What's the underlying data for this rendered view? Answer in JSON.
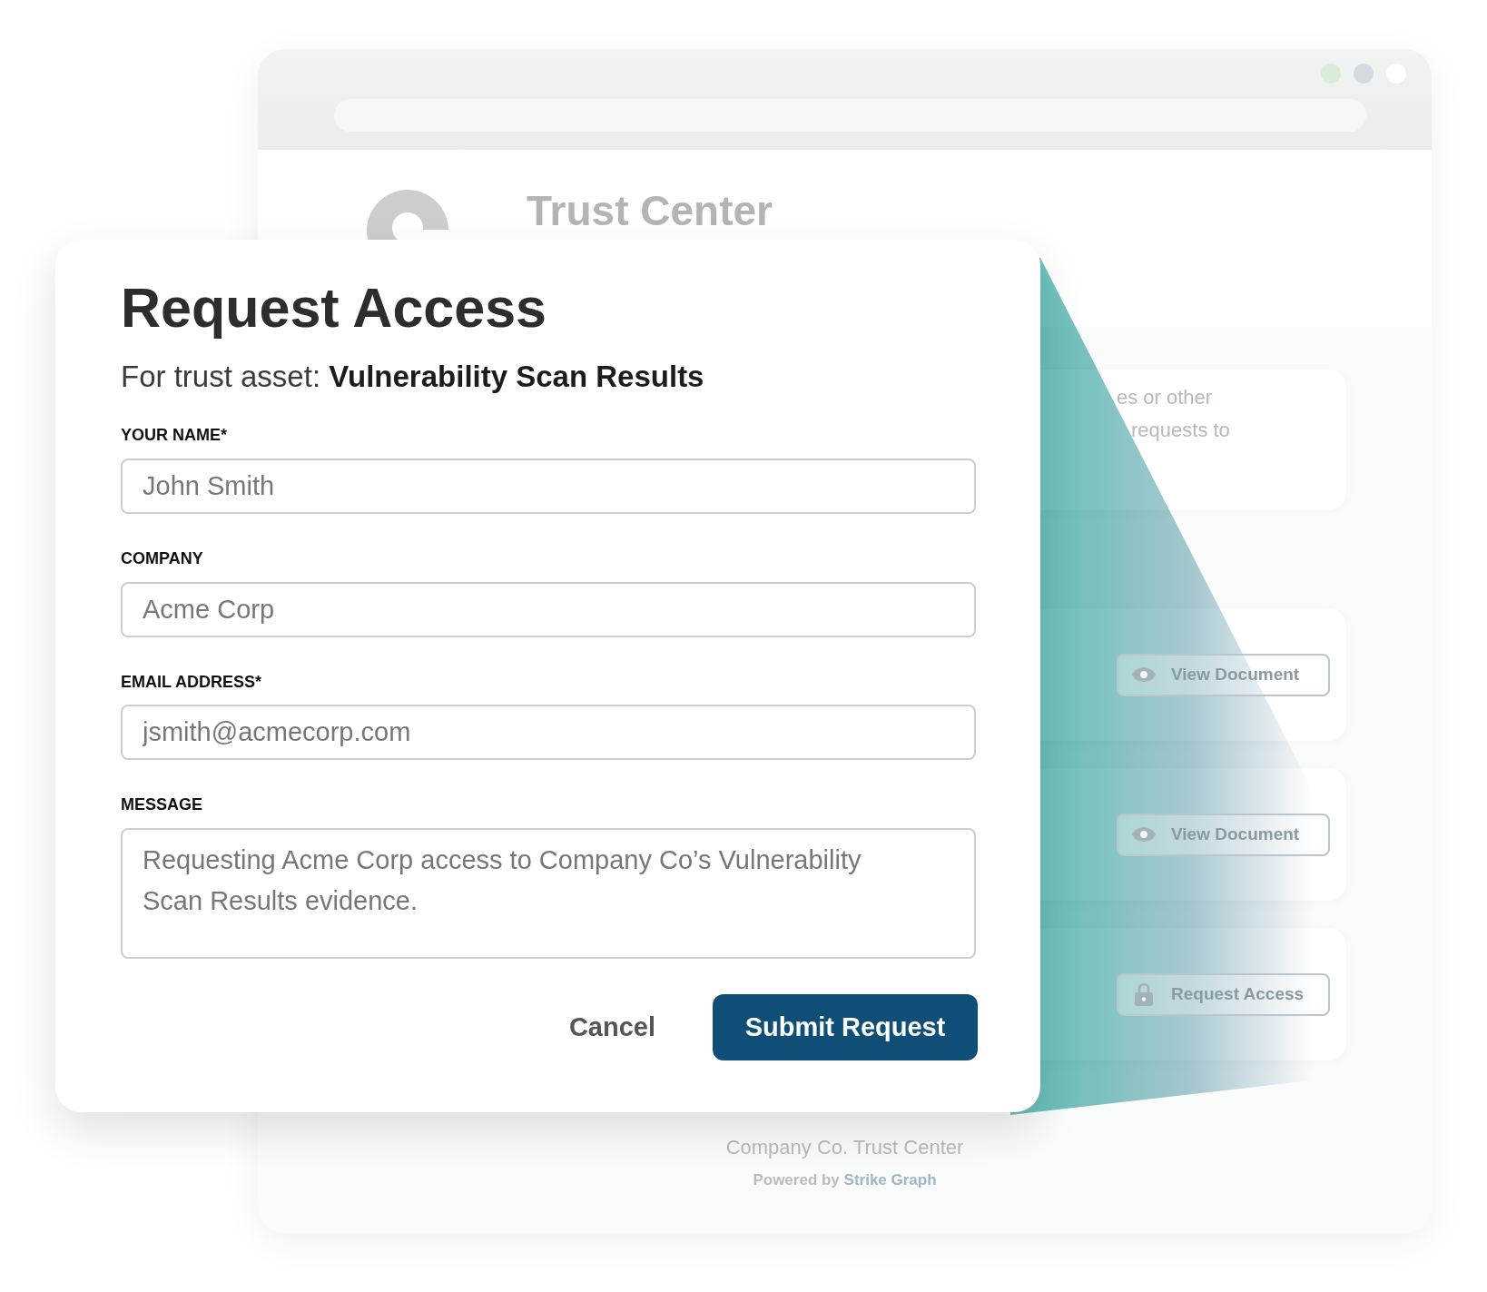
{
  "browser": {
    "header": {
      "title": "Trust Center"
    },
    "info_card": {
      "lines": [
        "es or other",
        "requests to"
      ]
    },
    "documents": [
      {
        "action": {
          "kind": "view",
          "label": "View Document"
        }
      },
      {
        "action": {
          "kind": "view",
          "label": "View Document"
        }
      },
      {
        "action": {
          "kind": "request",
          "label": "Request Access"
        }
      }
    ],
    "footer": {
      "title": "Company Co. Trust Center",
      "powered_by": "Powered by",
      "link": "Strike Graph"
    }
  },
  "dialog": {
    "title": "Request Access",
    "subtitle": "For trust asset: **Vulnerability Scan Results**",
    "fields": [
      {
        "kind": "text",
        "label": "YOUR NAME*",
        "placeholder": "John Smith"
      },
      {
        "kind": "text",
        "label": "COMPANY",
        "placeholder": "Acme Corp"
      },
      {
        "kind": "text",
        "label": "EMAIL ADDRESS*",
        "placeholder": "jsmith@acmecorp.com"
      },
      {
        "kind": "textarea",
        "label": "MESSAGE",
        "placeholder": "Requesting Acme Corp access to Company Co’s Vulnerability Scan Results evidence."
      }
    ],
    "buttons": [
      {
        "kind": "secondary",
        "label": "Cancel"
      },
      {
        "kind": "primary",
        "label": "Submit Request"
      }
    ]
  }
}
